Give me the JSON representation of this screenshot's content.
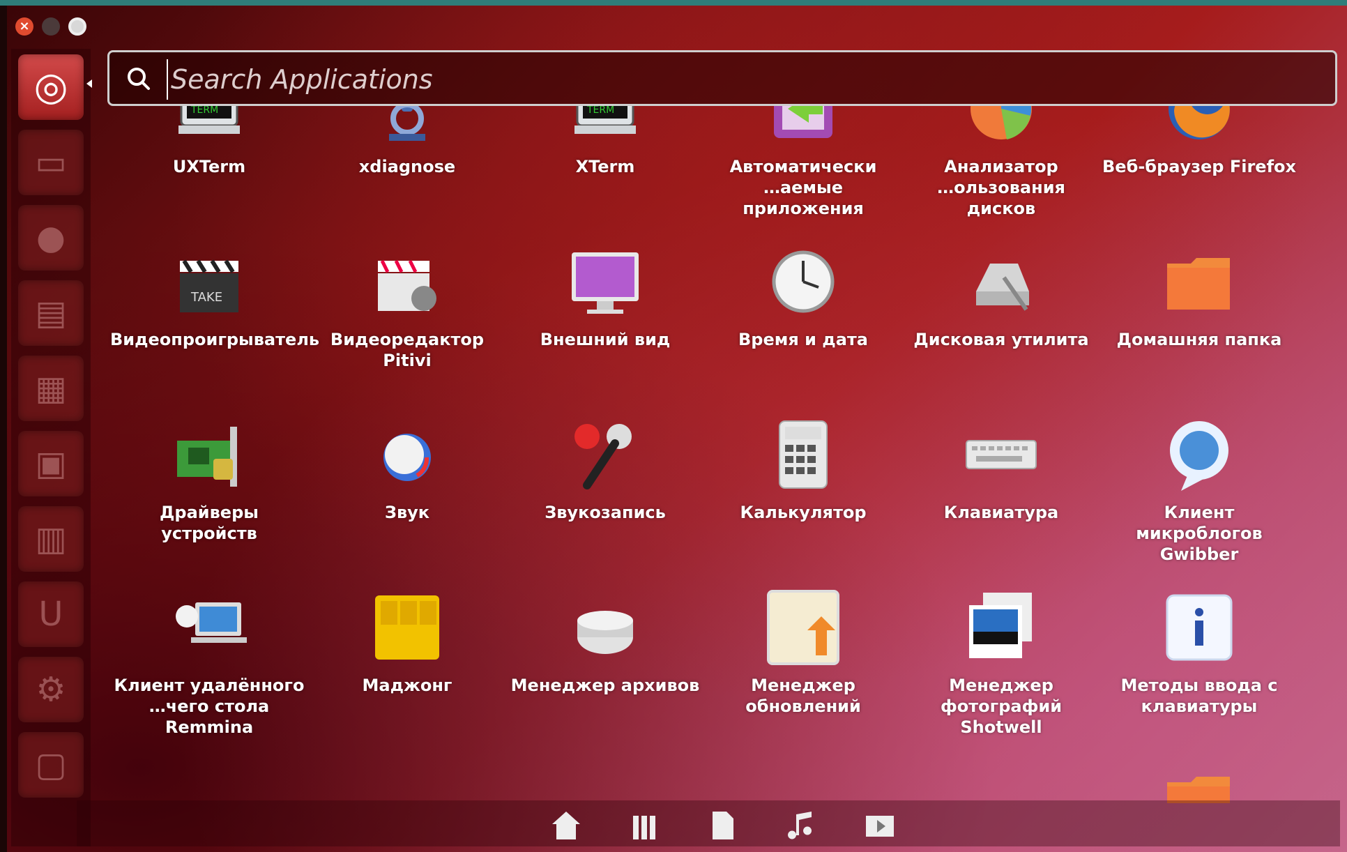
{
  "window": {
    "close_symbol": "×"
  },
  "search": {
    "placeholder": "Search Applications",
    "value": ""
  },
  "launcher": {
    "items": [
      {
        "name": "dash-icon",
        "glyph": "◎"
      },
      {
        "name": "files-icon",
        "glyph": "▭"
      },
      {
        "name": "firefox-icon",
        "glyph": "●"
      },
      {
        "name": "writer-icon",
        "glyph": "▤"
      },
      {
        "name": "calc-icon",
        "glyph": "▦"
      },
      {
        "name": "impress-icon",
        "glyph": "▣"
      },
      {
        "name": "software-center-icon",
        "glyph": "▥"
      },
      {
        "name": "ubuntu-one-icon",
        "glyph": "U"
      },
      {
        "name": "settings-icon",
        "glyph": "⚙"
      },
      {
        "name": "workspace-icon",
        "glyph": "▢"
      }
    ]
  },
  "apps": [
    {
      "label": "UXTerm",
      "icon": "terminal-icon"
    },
    {
      "label": "xdiagnose",
      "icon": "microscope-icon"
    },
    {
      "label": "XTerm",
      "icon": "terminal-icon"
    },
    {
      "label": "Автоматически\n…аемые приложения",
      "icon": "startup-apps-icon"
    },
    {
      "label": "Анализатор\n…ользования дисков",
      "icon": "pie-chart-icon"
    },
    {
      "label": "Веб-браузер Firefox",
      "icon": "firefox-icon"
    },
    {
      "label": "Видеопроигрыватель",
      "icon": "clapperboard-icon"
    },
    {
      "label": "Видеоредактор Pitivi",
      "icon": "video-editor-icon"
    },
    {
      "label": "Внешний вид",
      "icon": "monitor-icon"
    },
    {
      "label": "Время и дата",
      "icon": "clock-icon"
    },
    {
      "label": "Дисковая утилита",
      "icon": "disk-utility-icon"
    },
    {
      "label": "Домашняя папка",
      "icon": "folder-icon"
    },
    {
      "label": "Драйверы устройств",
      "icon": "driver-card-icon"
    },
    {
      "label": "Звук",
      "icon": "sound-icon"
    },
    {
      "label": "Звукозапись",
      "icon": "microphone-icon"
    },
    {
      "label": "Калькулятор",
      "icon": "calculator-icon"
    },
    {
      "label": "Клавиатура",
      "icon": "keyboard-icon"
    },
    {
      "label": "Клиент микроблогов\nGwibber",
      "icon": "speech-bubble-icon"
    },
    {
      "label": "Клиент удалённого\n…чего стола Remmina",
      "icon": "remote-desktop-icon"
    },
    {
      "label": "Маджонг",
      "icon": "mahjong-icon"
    },
    {
      "label": "Менеджер архивов",
      "icon": "archive-icon"
    },
    {
      "label": "Менеджер\nобновлений",
      "icon": "update-manager-icon"
    },
    {
      "label": "Менеджер\nфотографий Shotwell",
      "icon": "photos-icon"
    },
    {
      "label": "Методы ввода с\nклавиатуры",
      "icon": "info-icon"
    }
  ],
  "partial_row": [
    "app-icon",
    "app-icon",
    "app-icon",
    "app-icon",
    "app-icon",
    "folder-icon"
  ],
  "lenses": [
    {
      "name": "home-lens-icon"
    },
    {
      "name": "applications-lens-icon"
    },
    {
      "name": "files-lens-icon"
    },
    {
      "name": "music-lens-icon"
    },
    {
      "name": "video-lens-icon"
    }
  ]
}
